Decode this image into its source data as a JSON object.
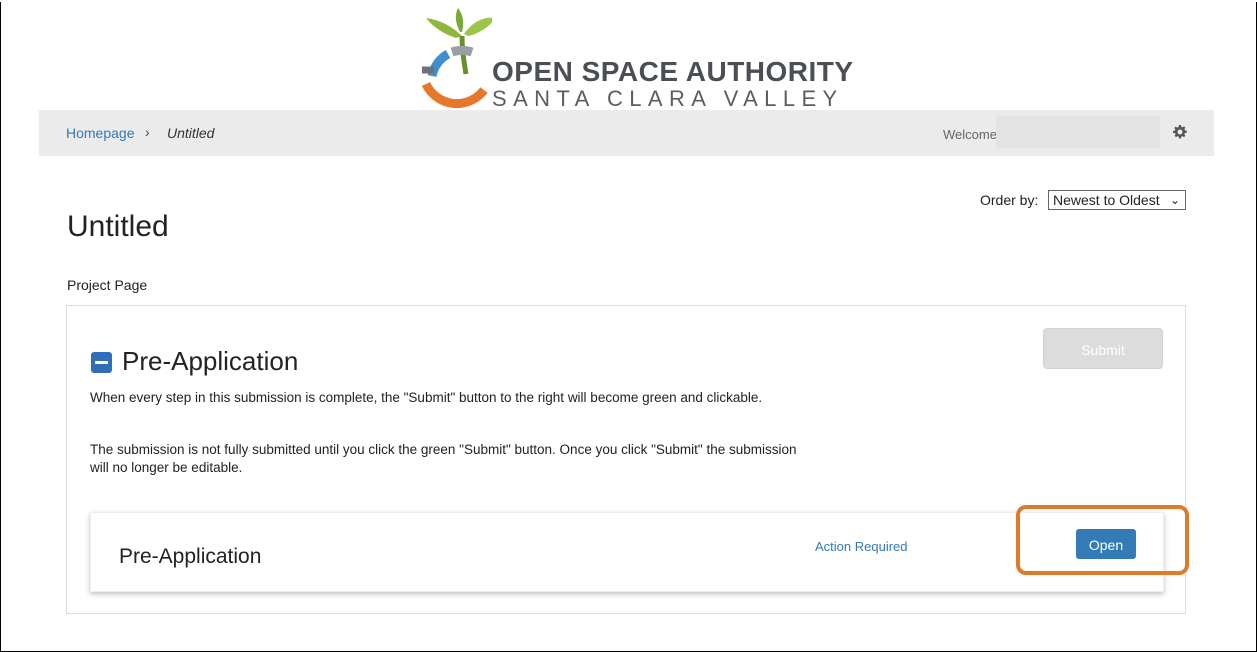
{
  "logo": {
    "line1": "OPEN SPACE AUTHORITY",
    "line2": "SANTA CLARA VALLEY",
    "colors": {
      "leaf": "#8cb83c",
      "stem": "#6b8f2a",
      "orange": "#e5782a",
      "blue": "#3f8fce",
      "gray": "#9a9da1"
    }
  },
  "navbar": {
    "breadcrumb_home": "Homepage",
    "breadcrumb_separator": "›",
    "breadcrumb_current": "Untitled",
    "welcome_label": "Welcome",
    "settings_icon": "gear-icon"
  },
  "order": {
    "label": "Order by:",
    "selected": "Newest to Oldest"
  },
  "page": {
    "title": "Untitled",
    "subtitle": "Project Page"
  },
  "section": {
    "collapse_icon": "minus-square-icon",
    "title": "Pre-Application",
    "paragraph1": "When every step in this submission is complete, the \"Submit\" button to the right will become green and clickable.",
    "paragraph2": "The submission is not fully submitted until you click the green \"Submit\" button. Once you click \"Submit\" the submission will no longer be editable.",
    "submit_label": "Submit",
    "item": {
      "title": "Pre-Application",
      "status": "Action Required",
      "open_label": "Open"
    }
  },
  "colors": {
    "accent": "#337ab7",
    "highlight": "#df7a2a",
    "disabled": "#dcdcdc"
  }
}
